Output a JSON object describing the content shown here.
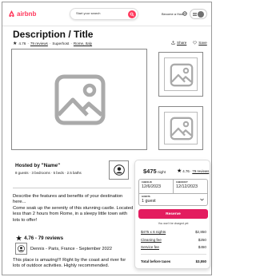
{
  "header": {
    "brand": "airbnb",
    "search_label": "Start your search",
    "host_link": "Become a Host"
  },
  "listing": {
    "title": "Description / Title",
    "rating": "4.76",
    "reviews_link": "79 reviews",
    "superhost": "Superhost",
    "location": "Rome, Italy",
    "separator": "·",
    "share_label": "Share",
    "save_label": "Save"
  },
  "host": {
    "hosted_by": "Hosted by \"Name\"",
    "details": "8 guests  ·  3 bedrooms  ·  5 beds  ·  2.5 baths"
  },
  "description": "Describe the features and benefits of your destination here...\nCome soak up the serenity of this stunning castle. Located less than 2 hours from Rome, in a sleepy little town with lots to offer!",
  "reviews": {
    "heading": "4.76 - 79 reviews",
    "author": "Dennis - Paris, France - September 2022",
    "body": "This place is amazing!!!  Right by the coast and river for lots of outdoor activities.  Highly recommended."
  },
  "booking": {
    "price": "$475",
    "per": "night",
    "rating": "4.76",
    "separator": "·",
    "reviews_link": "79 reviews",
    "checkin_label": "CHECK-IN",
    "checkin_value": "12/6/2023",
    "checkout_label": "CHECKOUT",
    "checkout_value": "12/12/2023",
    "guests_label": "GUESTS",
    "guests_value": "1 guest",
    "reserve_label": "Reserve",
    "no_charge_note": "You won't be charged yet",
    "nights_label": "$475 x 6 nights",
    "nights_value": "$2,850",
    "cleaning_label": "Cleaning fee",
    "cleaning_value": "$250",
    "service_label": "Service fee",
    "service_value": "$450",
    "total_label": "Total before taxes",
    "total_value": "$3,550"
  },
  "colors": {
    "brand": "#ff385c",
    "reserve": "#e31c5f"
  },
  "icons": [
    "airbnb-logo-icon",
    "search-icon",
    "globe-icon",
    "menu-icon",
    "user-avatar-icon",
    "star-icon",
    "share-icon",
    "heart-icon",
    "image-placeholder-icon",
    "chevron-down-icon"
  ]
}
